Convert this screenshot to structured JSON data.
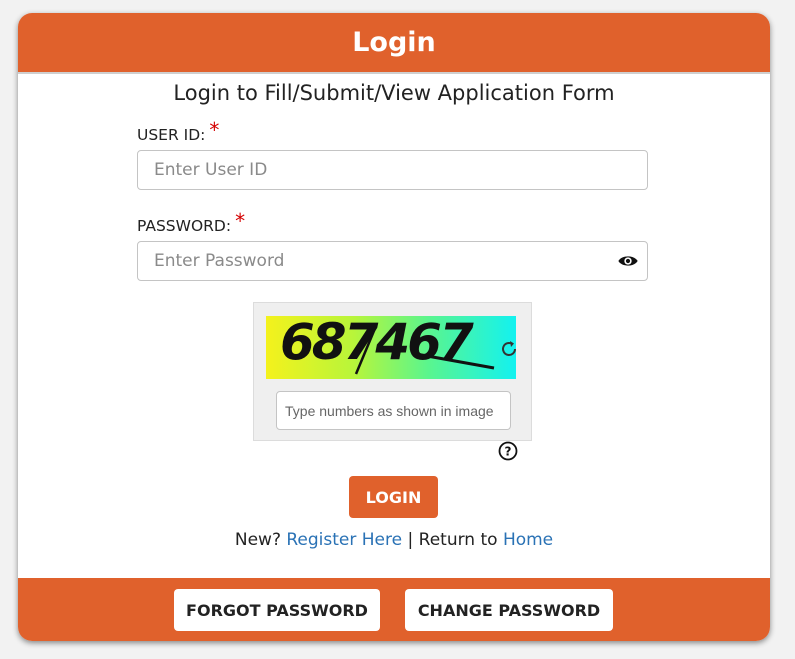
{
  "header": {
    "title": "Login"
  },
  "form": {
    "subtitle": "Login to Fill/Submit/View Application Form",
    "user_id_label": "USER ID:",
    "user_id_placeholder": "Enter User ID",
    "password_label": "PASSWORD:",
    "password_placeholder": "Enter Password",
    "required_mark": "*",
    "eye_icon": "eye-icon"
  },
  "captcha": {
    "code": "687467",
    "input_placeholder": "Type numbers as shown in image",
    "refresh_icon": "refresh-icon",
    "help_icon": "question-circle-icon",
    "gradient_colors": [
      "#f4f21c",
      "#13f2f0"
    ]
  },
  "login_button": "LOGIN",
  "links": {
    "new_text": "New?",
    "register_label": "Register Here",
    "separator": "|",
    "return_text": "Return to",
    "home_label": "Home"
  },
  "footer": {
    "forgot_label": "FORGOT PASSWORD",
    "change_label": "CHANGE PASSWORD"
  },
  "colors": {
    "accent": "#e0612c",
    "link": "#2a72b5",
    "required": "#d40000"
  }
}
